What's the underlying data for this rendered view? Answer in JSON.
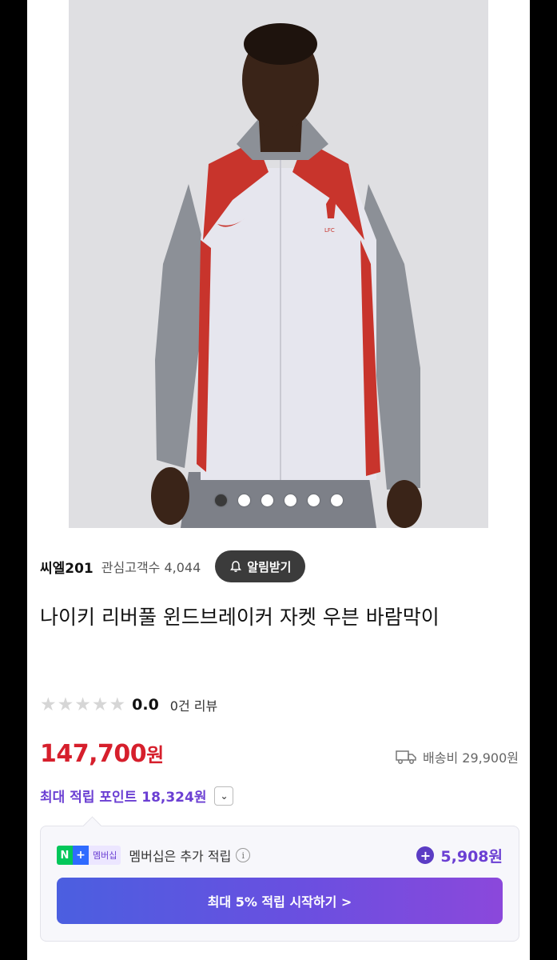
{
  "product_image": {
    "alt": "",
    "carousel": {
      "total": 6,
      "active_index": 0
    }
  },
  "seller": {
    "name": "씨엘201",
    "followers_label": "관심고객수 4,044",
    "notify_label": "알림받기"
  },
  "product": {
    "title": "나이키 리버풀 윈드브레이커 자켓 우븐 바람막이",
    "rating_value": "0.0",
    "rating_stars": 0,
    "review_count": "0건 리뷰",
    "price_number": "147,700",
    "price_unit": "원",
    "shipping": "배송비 29,900원",
    "max_points": "최대 적립 포인트 18,324원"
  },
  "membership": {
    "badge_n": "N",
    "badge_plus": "+",
    "badge_label": "멤버십",
    "text": "멤버십은 추가 적립",
    "info_glyph": "i",
    "points": "5,908원",
    "cta": "최대 5% 적립 시작하기 >"
  },
  "colors": {
    "price": "#d61f2c",
    "accent_purple": "#6b3fd3",
    "cta_gradient_start": "#4b5fe0",
    "cta_gradient_end": "#8b48db"
  }
}
